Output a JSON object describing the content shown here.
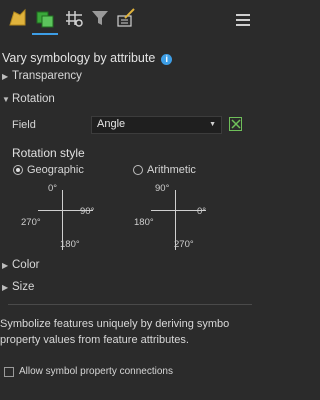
{
  "toolbar": {
    "tabs": [
      "primary-symbology-icon",
      "vary-by-attribute-icon",
      "symbol-layers-icon",
      "filter-icon",
      "advanced-options-icon"
    ],
    "active_index": 1,
    "accent": "#3d9ee6"
  },
  "panel_title": "Vary symbology by attribute",
  "sections": {
    "transparency": "Transparency",
    "rotation": "Rotation",
    "color": "Color",
    "size": "Size"
  },
  "rotation": {
    "field_label": "Field",
    "field_value": "Angle",
    "style_label": "Rotation style",
    "geographic_label": "Geographic",
    "arithmetic_label": "Arithmetic",
    "selected_style": "Geographic",
    "geographic_diagram": {
      "top": "0°",
      "right": "90°",
      "bottom": "180°",
      "left": "270°"
    },
    "arithmetic_diagram": {
      "top": "90°",
      "right": "0°",
      "bottom": "270°",
      "left": "180°"
    }
  },
  "description": {
    "line1": "Symbolize features uniquely by deriving symbo",
    "line2": "property values from feature attributes."
  },
  "allow_connections_label": "Allow symbol property connections"
}
